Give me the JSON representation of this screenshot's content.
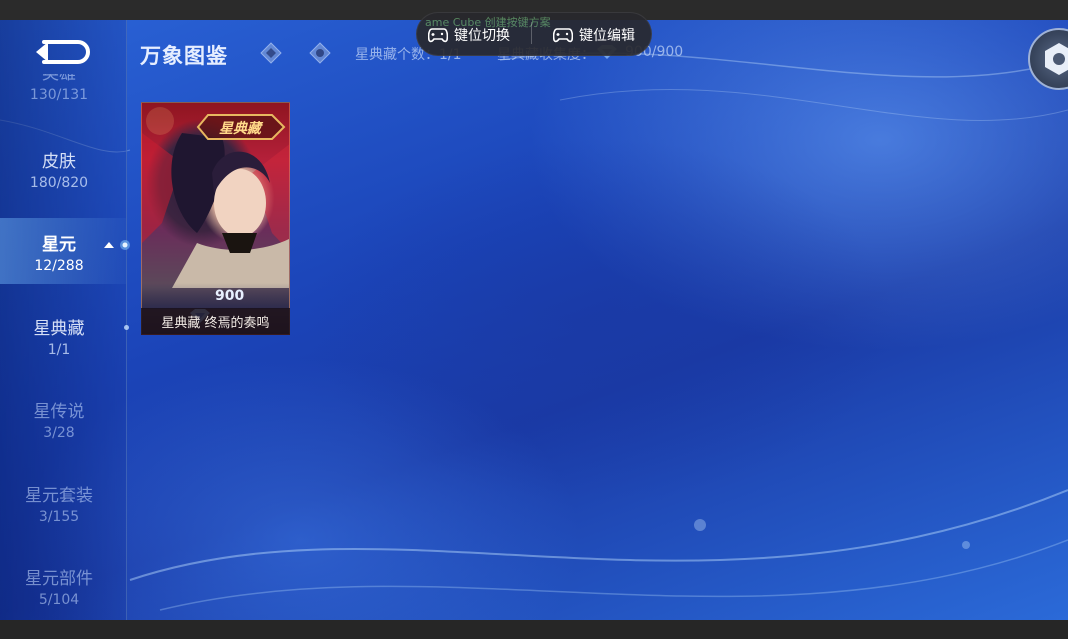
{
  "window": {
    "title": ""
  },
  "page": {
    "title": "万象图鉴"
  },
  "stats": {
    "count_label": "星典藏个数：",
    "count_value": "1/1",
    "collect_label": "星典藏收集度：",
    "collect_value": "900/900"
  },
  "sidebar": {
    "items": [
      {
        "label": "英雄",
        "count": "130/131"
      },
      {
        "label": "皮肤",
        "count": "180/820"
      },
      {
        "label": "星元",
        "count": "12/288"
      },
      {
        "label": "星典藏",
        "count": "1/1"
      },
      {
        "label": "星传说",
        "count": "3/28"
      },
      {
        "label": "星元套装",
        "count": "3/155"
      },
      {
        "label": "星元部件",
        "count": "5/104"
      }
    ],
    "active_index": 2
  },
  "cards": [
    {
      "badge": "星典藏",
      "score": "900",
      "name": "星典藏 终焉的奏鸣"
    }
  ],
  "overlay": {
    "under_text": "ame Cube  创建按键方案",
    "switch_label": "键位切换",
    "edit_label": "键位编辑"
  },
  "icons": {
    "back": "back-arrow-icon",
    "filter1": "diamond-filter-icon",
    "filter2": "orb-filter-icon",
    "gem": "gem-icon",
    "gamepad": "gamepad-icon",
    "settings": "hexagon-settings-icon"
  },
  "colors": {
    "background": "#1b44b8",
    "accent": "#8fd0ff",
    "title": "#e6eeff"
  }
}
